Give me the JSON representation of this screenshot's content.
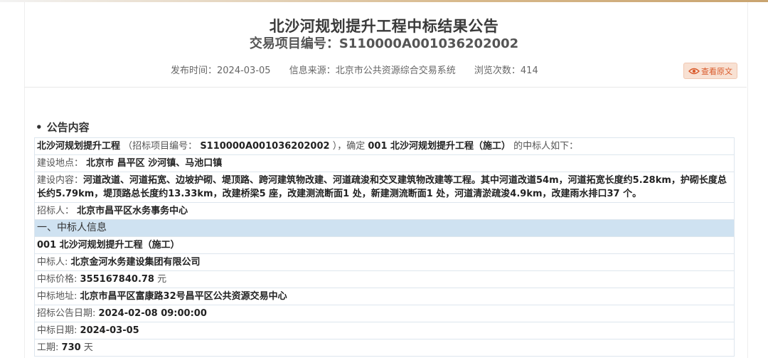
{
  "header": {
    "title": "北沙河规划提升工程中标结果公告",
    "subtitle_label": "交易项目编号：",
    "subtitle_code": "S110000A001036202002"
  },
  "meta": {
    "publish_label": "发布时间：",
    "publish_value": "2024-03-05",
    "source_label": "信息来源：",
    "source_value": "北京市公共资源综合交易系统",
    "views_label": "浏览次数：",
    "views_value": "414"
  },
  "view_original": {
    "label": "查看原文",
    "icon": "eye-icon"
  },
  "section": {
    "bullet": "•",
    "title": "公告内容"
  },
  "intro": {
    "project": "北沙河规划提升工程",
    "code_label": "（招标项目编号：",
    "code_value": "S110000A001036202002",
    "confirm": "），确定",
    "lot": "001 北沙河规划提升工程（施工）",
    "suffix": "的中标人如下："
  },
  "location": {
    "label": "建设地点：",
    "value": "北京市 昌平区 沙河镇、马池口镇"
  },
  "scope": {
    "label": "建设内容：",
    "value": "河道改道、河道拓宽、边坡护砌、堤顶路、跨河建筑物改建、河道疏浚和交叉建筑物改建等工程。其中河道改道54m，河道拓宽长度约5.28km，护砌长度总长约5.79km，堤顶路总长度约13.33km，改建桥梁5 座，改建测流断面1 处，新建测流断面1 处，河道清淤疏浚4.9km，改建雨水排口37 个。"
  },
  "tenderer": {
    "label": "招标人：",
    "value": "北京市昌平区水务事务中心"
  },
  "winner_section": {
    "heading": "一、中标人信息",
    "lot": "001 北沙河规划提升工程（施工）",
    "winner_label": "中标人:",
    "winner_value": "北京金河水务建设集团有限公司",
    "price_label": "中标价格:",
    "price_value": "355167840.78",
    "price_unit": "元",
    "address_label": "中标地址:",
    "address_value": "北京市昌平区富康路32号昌平区公共资源交易中心",
    "notice_date_label": "招标公告日期:",
    "notice_date_value": "2024-02-08 09:00:00",
    "award_date_label": "中标日期:",
    "award_date_value": "2024-03-05",
    "duration_label": "工期:",
    "duration_value": "730",
    "duration_unit": "天"
  },
  "colors": {
    "accent": "#d95a2b",
    "section_bg": "#cfe2f1",
    "border": "#dde6ee"
  }
}
